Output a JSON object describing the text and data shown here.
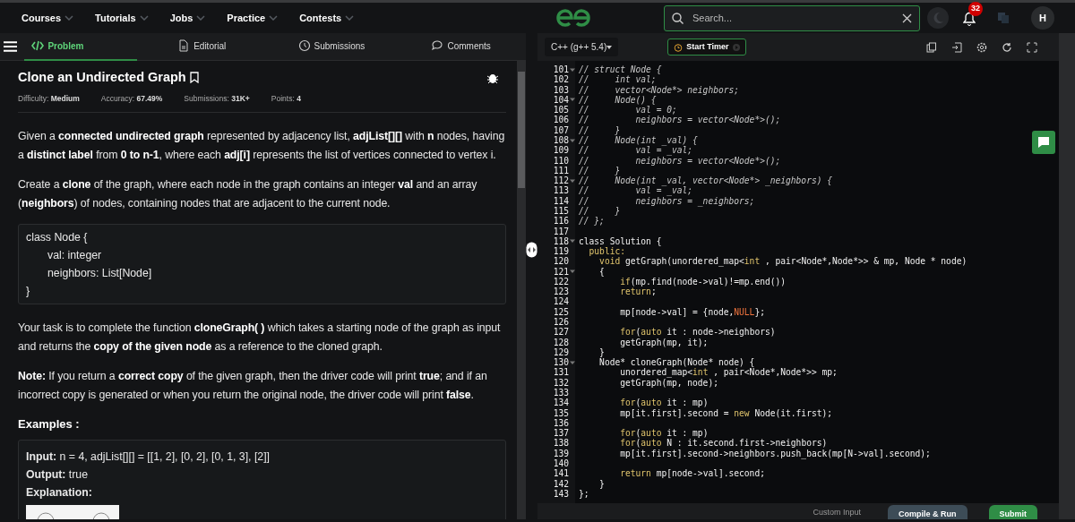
{
  "top_nav": {
    "menus": [
      {
        "label": "Courses"
      },
      {
        "label": "Tutorials"
      },
      {
        "label": "Jobs"
      },
      {
        "label": "Practice"
      },
      {
        "label": "Contests"
      }
    ],
    "search": {
      "placeholder": "Search..."
    },
    "notifications": "32",
    "avatar": "H"
  },
  "problem_tabs": [
    {
      "label": "Problem",
      "selected": true
    },
    {
      "label": "Editorial",
      "selected": false
    },
    {
      "label": "Submissions",
      "selected": false
    },
    {
      "label": "Comments",
      "selected": false
    }
  ],
  "problem": {
    "title": "Clone an Undirected Graph",
    "meta": [
      {
        "label": "Difficulty:",
        "value": "Medium"
      },
      {
        "label": "Accuracy:",
        "value": "67.49%"
      },
      {
        "label": "Submissions:",
        "value": "31K+"
      },
      {
        "label": "Points:",
        "value": "4"
      }
    ],
    "paragraphs_1": [
      "Given a **connected undirected graph** represented by adjacency list, **adjList[][]** with **n** nodes, having a **distinct label** from **0 to n-1**, where each **adj[i]** represents the list of vertices connected to vertex i.",
      "Create a **clone** of the graph, where each node in the graph contains an integer **val** and an array (**neighbors**) of nodes, containing nodes that are adjacent to the current node."
    ],
    "class_block": [
      "class  Node  {",
      "val:  integer",
      "neighbors:  List[Node]",
      "}"
    ],
    "paragraphs_2": [
      "Your task is to complete the function **cloneGraph( )** which takes a starting node of the graph as input and returns the **copy of the given node** as a reference to the cloned graph.",
      "**Note:** If you return a **correct copy** of the given graph, then the driver code will print **true**; and if an incorrect copy is generated or when you return the original node, the driver code will print **false**."
    ],
    "examples_heading": "Examples :",
    "example": [
      {
        "label": "Input:",
        "value": "n  =  4,  adjList[][]  =  [[1,  2],  [0,  2],  [0,  1,  3],  [2]]"
      },
      {
        "label": "Output:",
        "value": "true"
      },
      {
        "label": "Explanation:"
      }
    ]
  },
  "editor": {
    "language": "C++ (g++ 5.4)",
    "timer": "Start Timer",
    "lines": [
      {
        "number": "101",
        "fold": true,
        "segments": [
          {
            "t": "// struct Node {",
            "kind": "comment"
          }
        ]
      },
      {
        "number": "102",
        "fold": false,
        "segments": [
          {
            "t": "//     int val;",
            "kind": "comment"
          }
        ]
      },
      {
        "number": "103",
        "fold": false,
        "segments": [
          {
            "t": "//     vector<Node*> neighbors;",
            "kind": "comment"
          }
        ]
      },
      {
        "number": "104",
        "fold": true,
        "segments": [
          {
            "t": "//     Node() {",
            "kind": "comment"
          }
        ]
      },
      {
        "number": "105",
        "fold": false,
        "segments": [
          {
            "t": "//         val = 0;",
            "kind": "comment"
          }
        ]
      },
      {
        "number": "106",
        "fold": false,
        "segments": [
          {
            "t": "//         neighbors = vector<Node*>();",
            "kind": "comment"
          }
        ]
      },
      {
        "number": "107",
        "fold": false,
        "segments": [
          {
            "t": "//     }",
            "kind": "comment"
          }
        ]
      },
      {
        "number": "108",
        "fold": true,
        "segments": [
          {
            "t": "//     Node(int _val) {",
            "kind": "comment"
          }
        ]
      },
      {
        "number": "109",
        "fold": false,
        "segments": [
          {
            "t": "//         val = _val;",
            "kind": "comment"
          }
        ]
      },
      {
        "number": "110",
        "fold": false,
        "segments": [
          {
            "t": "//         neighbors = vector<Node*>();",
            "kind": "comment"
          }
        ]
      },
      {
        "number": "111",
        "fold": false,
        "segments": [
          {
            "t": "//     }",
            "kind": "comment"
          }
        ]
      },
      {
        "number": "112",
        "fold": true,
        "segments": [
          {
            "t": "//     Node(int _val, vector<Node*> _neighbors) {",
            "kind": "comment"
          }
        ]
      },
      {
        "number": "113",
        "fold": false,
        "segments": [
          {
            "t": "//         val = _val;",
            "kind": "comment"
          }
        ]
      },
      {
        "number": "114",
        "fold": false,
        "segments": [
          {
            "t": "//         neighbors = _neighbors;",
            "kind": "comment"
          }
        ]
      },
      {
        "number": "115",
        "fold": false,
        "segments": [
          {
            "t": "//     }",
            "kind": "comment"
          }
        ]
      },
      {
        "number": "116",
        "fold": false,
        "segments": [
          {
            "t": "// };",
            "kind": "comment"
          }
        ]
      },
      {
        "number": "117",
        "fold": false
      },
      {
        "number": "118",
        "fold": true,
        "segments": [
          {
            "t": "class Solution {",
            "kind": "plain"
          }
        ]
      },
      {
        "number": "119",
        "fold": false,
        "segments": [
          {
            "t": "  public:",
            "kind": "kw"
          }
        ]
      },
      {
        "number": "120",
        "fold": false,
        "segments": [
          {
            "t": "    void",
            "kind": "kw"
          },
          {
            "t": " getGraph(unordered_map<",
            "kind": "plain"
          },
          {
            "t": "int",
            "kind": "kw"
          },
          {
            "t": " , pair<Node*,Node*>> & mp, Node * node)",
            "kind": "plain"
          }
        ]
      },
      {
        "number": "121",
        "fold": true,
        "segments": [
          {
            "t": "    {",
            "kind": "plain"
          }
        ]
      },
      {
        "number": "122",
        "fold": false,
        "segments": [
          {
            "t": "        if",
            "kind": "kw"
          },
          {
            "t": "(mp.find(node->val)!=mp.end())",
            "kind": "plain"
          }
        ]
      },
      {
        "number": "123",
        "fold": false,
        "segments": [
          {
            "t": "        return",
            "kind": "kw"
          },
          {
            "t": ";",
            "kind": "plain"
          }
        ]
      },
      {
        "number": "124",
        "fold": false
      },
      {
        "number": "125",
        "fold": false,
        "segments": [
          {
            "t": "        mp[node->val] = {node,",
            "kind": "plain"
          },
          {
            "t": "NULL",
            "kind": "const"
          },
          {
            "t": "};",
            "kind": "plain"
          }
        ]
      },
      {
        "number": "126",
        "fold": false
      },
      {
        "number": "127",
        "fold": false,
        "segments": [
          {
            "t": "        for",
            "kind": "kw"
          },
          {
            "t": "(",
            "kind": "plain"
          },
          {
            "t": "auto",
            "kind": "kw"
          },
          {
            "t": " it : node->neighbors)",
            "kind": "plain"
          }
        ]
      },
      {
        "number": "128",
        "fold": false,
        "segments": [
          {
            "t": "        getGraph(mp, it);",
            "kind": "plain"
          }
        ]
      },
      {
        "number": "129",
        "fold": false,
        "segments": [
          {
            "t": "    }",
            "kind": "plain"
          }
        ]
      },
      {
        "number": "130",
        "fold": true,
        "segments": [
          {
            "t": "    Node* cloneGraph(Node* node) {",
            "kind": "plain"
          }
        ]
      },
      {
        "number": "131",
        "fold": false,
        "segments": [
          {
            "t": "        unordered_map<",
            "kind": "plain"
          },
          {
            "t": "int",
            "kind": "kw"
          },
          {
            "t": " , pair<Node*,Node*>> mp;",
            "kind": "plain"
          }
        ]
      },
      {
        "number": "132",
        "fold": false,
        "segments": [
          {
            "t": "        getGraph(mp, node);",
            "kind": "plain"
          }
        ]
      },
      {
        "number": "133",
        "fold": false
      },
      {
        "number": "134",
        "fold": false,
        "segments": [
          {
            "t": "        for",
            "kind": "kw"
          },
          {
            "t": "(",
            "kind": "plain"
          },
          {
            "t": "auto",
            "kind": "kw"
          },
          {
            "t": " it : mp)",
            "kind": "plain"
          }
        ]
      },
      {
        "number": "135",
        "fold": false,
        "segments": [
          {
            "t": "        mp[it.first].second = ",
            "kind": "plain"
          },
          {
            "t": "new",
            "kind": "kw"
          },
          {
            "t": " Node(it.first);",
            "kind": "plain"
          }
        ]
      },
      {
        "number": "136",
        "fold": false
      },
      {
        "number": "137",
        "fold": false,
        "segments": [
          {
            "t": "        for",
            "kind": "kw"
          },
          {
            "t": "(",
            "kind": "plain"
          },
          {
            "t": "auto",
            "kind": "kw"
          },
          {
            "t": " it : mp)",
            "kind": "plain"
          }
        ]
      },
      {
        "number": "138",
        "fold": false,
        "segments": [
          {
            "t": "        for",
            "kind": "kw"
          },
          {
            "t": "(",
            "kind": "plain"
          },
          {
            "t": "auto",
            "kind": "kw"
          },
          {
            "t": " N : it.second.first->neighbors)",
            "kind": "plain"
          }
        ]
      },
      {
        "number": "139",
        "fold": false,
        "segments": [
          {
            "t": "        mp[it.first].second->neighbors.push_back(mp[N->val].second);",
            "kind": "plain"
          }
        ]
      },
      {
        "number": "140",
        "fold": false
      },
      {
        "number": "141",
        "fold": false,
        "segments": [
          {
            "t": "        return",
            "kind": "kw"
          },
          {
            "t": " mp[node->val].second;",
            "kind": "plain"
          }
        ]
      },
      {
        "number": "142",
        "fold": false,
        "segments": [
          {
            "t": "    }",
            "kind": "plain"
          }
        ]
      },
      {
        "number": "143",
        "fold": false,
        "segments": [
          {
            "t": "};",
            "kind": "plain"
          }
        ]
      }
    ],
    "actions": [
      {
        "label": "Custom Input",
        "kind": "link"
      },
      {
        "label": "Compile & Run",
        "kind": "secondary"
      },
      {
        "label": "Submit",
        "kind": "primary"
      }
    ]
  }
}
